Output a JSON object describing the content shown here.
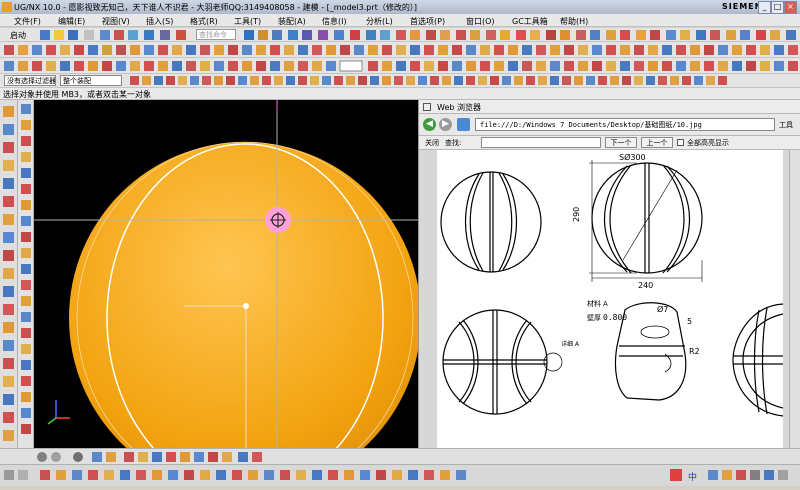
{
  "window": {
    "title": "UG/NX 10.0 - 愿影视致无知己，天下谁人不识君 - 大羽老师QQ:3149408058 - 建模 - [_model3.prt（修改的）]",
    "brand": "SIEMENS",
    "min": "_",
    "max": "□",
    "close": "×"
  },
  "menu": {
    "items": [
      "文件(F)",
      "编辑(E)",
      "视图(V)",
      "插入(S)",
      "格式(R)",
      "工具(T)",
      "装配(A)",
      "信息(I)",
      "分析(L)",
      "首选项(P)",
      "窗口(O)",
      "GC工具箱",
      "帮助(H)"
    ]
  },
  "toolbar": {
    "start_label": "启动",
    "search_placeholder": "查找命令"
  },
  "selection": {
    "filter_value": "没有选择过滤器",
    "scope_value": "整个装配"
  },
  "prompt": {
    "text": "选择对象并使用 MB3，或者双击某一对象"
  },
  "browser": {
    "title": "Web 浏览器",
    "address": "file:///D:/Windows 7 Documents/Desktop/基础图纸/10.jpg",
    "tools_label": "工具",
    "close_label": "关闭",
    "find_label": "查找:",
    "next_label": "下一个",
    "prev_label": "上一个",
    "highlight_label": "全部高亮显示"
  },
  "drawing": {
    "dim_diameter": "SØ300",
    "dim_height": "290",
    "dim_width": "240",
    "material_label": "材料",
    "material_value": "A",
    "thickness_label": "壁厚",
    "thickness_value": "0.800",
    "detail_label": "详细 A",
    "dim_hole": "Ø7",
    "dim_slot": "5",
    "dim_radius": "R2"
  },
  "colors": {
    "ball": "#f2a20e",
    "highlight": "#ff5fd8"
  },
  "taskbar": {
    "ime": "中"
  }
}
